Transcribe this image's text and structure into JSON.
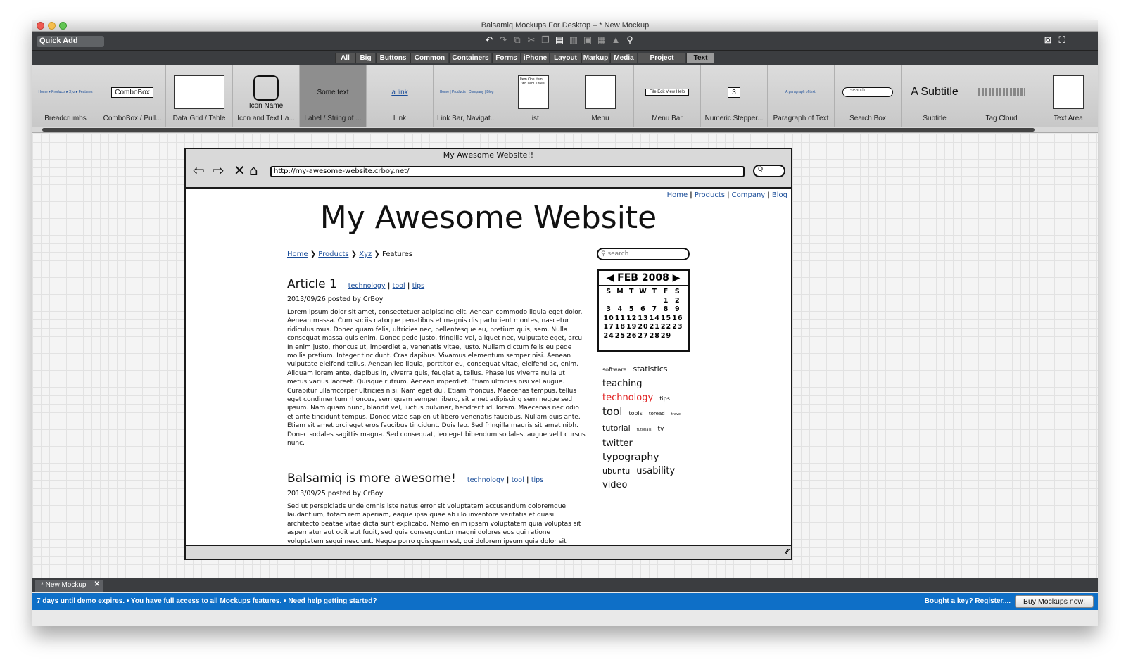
{
  "window": {
    "title": "Balsamiq Mockups For Desktop – * New Mockup"
  },
  "toolbar": {
    "quick_add": "Quick Add"
  },
  "categories": [
    "All",
    "Big",
    "Buttons",
    "Common",
    "Containers",
    "Forms",
    "iPhone",
    "Layout",
    "Markup",
    "Media",
    "Project Assets",
    "Text"
  ],
  "selected_category": "Text",
  "ribbon": [
    {
      "label": "Breadcrumbs",
      "thumb": "Home ▸ Products ▸ Xyz ▸ Features"
    },
    {
      "label": "ComboBox / Pull...",
      "thumb": "ComboBox"
    },
    {
      "label": "Data Grid / Table",
      "thumb": ""
    },
    {
      "label": "Icon and Text La...",
      "thumb": "Icon Name"
    },
    {
      "label": "Label / String of ...",
      "thumb": "Some text"
    },
    {
      "label": "Link",
      "thumb": "a link"
    },
    {
      "label": "Link Bar, Navigat...",
      "thumb": "Home | Products | Company | Blog"
    },
    {
      "label": "List",
      "thumb": "Item One Item Two Item Three"
    },
    {
      "label": "Menu",
      "thumb": ""
    },
    {
      "label": "Menu Bar",
      "thumb": "File  Edit  View  Help"
    },
    {
      "label": "Numeric Stepper...",
      "thumb": "3"
    },
    {
      "label": "Paragraph of Text",
      "thumb": "A paragraph of text."
    },
    {
      "label": "Search Box",
      "thumb": "search"
    },
    {
      "label": "Subtitle",
      "thumb": "A Subtitle"
    },
    {
      "label": "Tag Cloud",
      "thumb": ""
    },
    {
      "label": "Text Area",
      "thumb": ""
    }
  ],
  "browser": {
    "title": "My Awesome Website!!",
    "url": "http://my-awesome-website.crboy.net/",
    "search": "Q"
  },
  "site": {
    "nav": [
      "Home",
      "Products",
      "Company",
      "Blog"
    ],
    "title": "My Awesome Website",
    "breadcrumb": [
      "Home",
      "Products",
      "Xyz",
      "Features"
    ],
    "articles": [
      {
        "title": "Article 1",
        "tags": [
          "technology",
          "tool",
          "tips"
        ],
        "meta": "2013/09/26 posted by CrBoy",
        "body": "Lorem ipsum dolor sit amet, consectetuer adipiscing elit. Aenean commodo ligula eget dolor. Aenean massa. Cum sociis natoque penatibus et magnis dis parturient montes, nascetur ridiculus mus. Donec quam felis, ultricies nec, pellentesque eu, pretium quis, sem. Nulla consequat massa quis enim. Donec pede justo, fringilla vel, aliquet nec, vulputate eget, arcu. In enim justo, rhoncus ut, imperdiet a, venenatis vitae, justo. Nullam dictum felis eu pede mollis pretium. Integer tincidunt. Cras dapibus. Vivamus elementum semper nisi. Aenean vulputate eleifend tellus. Aenean leo ligula, porttitor eu, consequat vitae, eleifend ac, enim. Aliquam lorem ante, dapibus in, viverra quis, feugiat a, tellus. Phasellus viverra nulla ut metus varius laoreet. Quisque rutrum. Aenean imperdiet. Etiam ultricies nisi vel augue. Curabitur ullamcorper ultricies nisi. Nam eget dui. Etiam rhoncus. Maecenas tempus, tellus eget condimentum rhoncus, sem quam semper libero, sit amet adipiscing sem neque sed ipsum. Nam quam nunc, blandit vel, luctus pulvinar, hendrerit id, lorem. Maecenas nec odio et ante tincidunt tempus. Donec vitae sapien ut libero venenatis faucibus. Nullam quis ante. Etiam sit amet orci eget eros faucibus tincidunt. Duis leo. Sed fringilla mauris sit amet nibh. Donec sodales sagittis magna. Sed consequat, leo eget bibendum sodales, augue velit cursus nunc,"
      },
      {
        "title": "Balsamiq is more awesome!",
        "tags": [
          "technology",
          "tool",
          "tips"
        ],
        "meta": "2013/09/25 posted by CrBoy",
        "body": "Sed ut perspiciatis unde omnis iste natus error sit voluptatem accusantium doloremque laudantium, totam rem aperiam, eaque ipsa quae ab illo inventore veritatis et quasi architecto beatae vitae dicta sunt explicabo. Nemo enim ipsam voluptatem quia voluptas sit aspernatur aut odit aut fugit, sed quia consequuntur magni dolores eos qui ratione voluptatem sequi nesciunt. Neque porro quisquam est, qui dolorem ipsum quia dolor sit"
      }
    ],
    "search_placeholder": "search",
    "calendar": {
      "month": "FEB 2008",
      "days": "SMTWTFS",
      "rows": [
        [
          "",
          "",
          "",
          "",
          "",
          "1",
          "2"
        ],
        [
          "3",
          "4",
          "5",
          "6",
          "7",
          "8",
          "9"
        ],
        [
          "10",
          "11",
          "12",
          "13",
          "14",
          "15",
          "16"
        ],
        [
          "17",
          "18",
          "19",
          "20",
          "21",
          "22",
          "23"
        ],
        [
          "24",
          "25",
          "26",
          "27",
          "28",
          "29",
          ""
        ]
      ]
    },
    "tagcloud": [
      {
        "t": "software",
        "s": 8
      },
      {
        "t": "statistics",
        "s": 11
      },
      {
        "t": "teaching",
        "s": 13
      },
      {
        "t": "technology",
        "s": 13,
        "c": "#e02020"
      },
      {
        "t": "tips",
        "s": 8
      },
      {
        "t": "tool",
        "s": 15
      },
      {
        "t": "tools",
        "s": 8
      },
      {
        "t": "toread",
        "s": 7
      },
      {
        "t": "travel",
        "s": 5
      },
      {
        "t": "tutorial",
        "s": 11
      },
      {
        "t": "tutorials",
        "s": 5
      },
      {
        "t": "tv",
        "s": 9
      },
      {
        "t": "twitter",
        "s": 13
      },
      {
        "t": "typography",
        "s": 14
      },
      {
        "t": "ubuntu",
        "s": 11
      },
      {
        "t": "usability",
        "s": 13
      },
      {
        "t": "video",
        "s": 13
      }
    ]
  },
  "tabs": {
    "doc": "* New Mockup"
  },
  "demo": {
    "text1": "7 days until demo expires. • You have full access to all Mockups features. • ",
    "help_link": "Need help getting started?",
    "bought": "Bought a key?",
    "register": "Register....",
    "buy": "Buy Mockups now!"
  }
}
